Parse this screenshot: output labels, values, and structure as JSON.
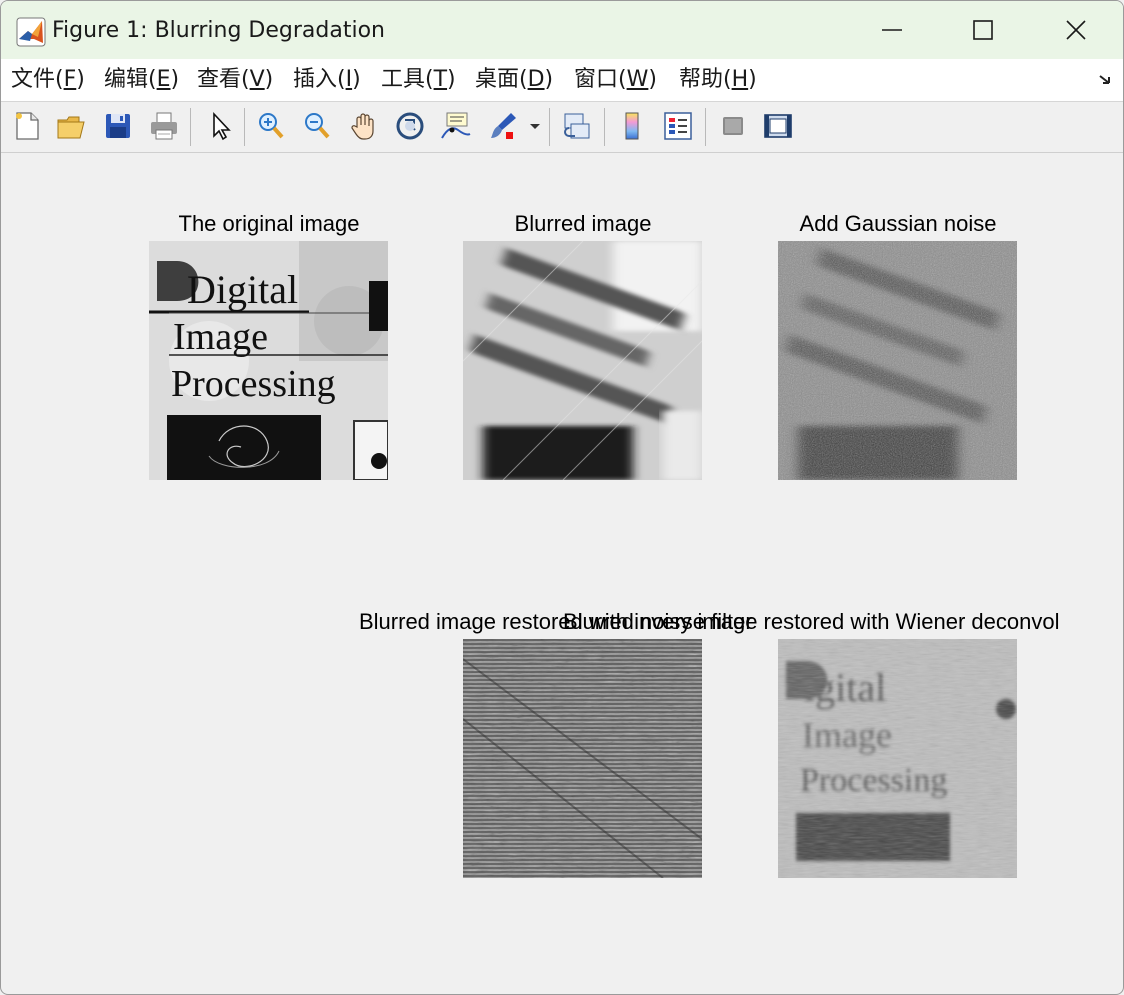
{
  "window": {
    "title": "Figure 1: Blurring Degradation",
    "titlebar_color": "#eaf5e6"
  },
  "menu": [
    {
      "text": "文件(",
      "key": "F",
      "end": ")"
    },
    {
      "text": "编辑(",
      "key": "E",
      "end": ")"
    },
    {
      "text": "查看(",
      "key": "V",
      "end": ")"
    },
    {
      "text": "插入(",
      "key": "I",
      "end": ")"
    },
    {
      "text": "工具(",
      "key": "T",
      "end": ")"
    },
    {
      "text": "桌面(",
      "key": "D",
      "end": ")"
    },
    {
      "text": "窗口(",
      "key": "W",
      "end": ")"
    },
    {
      "text": "帮助(",
      "key": "H",
      "end": ")"
    }
  ],
  "toolbar": [
    "new-figure-icon",
    "open-file-icon",
    "save-icon",
    "print-icon",
    "edit-plot-cursor-icon",
    "zoom-in-icon",
    "zoom-out-icon",
    "pan-hand-icon",
    "rotate-3d-icon",
    "data-cursor-icon",
    "brush-icon",
    "brush-dropdown-icon",
    "link-plot-icon",
    "colorbar-icon",
    "legend-icon",
    "hide-plot-tools-icon",
    "show-plot-tools-icon"
  ],
  "subplots": [
    {
      "title": "The original image",
      "content": "original"
    },
    {
      "title": "Blurred image",
      "content": "blurred"
    },
    {
      "title": "Add Gaussian noise",
      "content": "noisy"
    },
    {
      "title": "Blurred image restored with inverse filter",
      "content": "inverse"
    },
    {
      "title": "Blurred noisy image restored with Wiener deconvol",
      "content": "wiener"
    }
  ],
  "image_text": {
    "line1": "Digital",
    "line2": "Image",
    "line3": "Processing"
  }
}
